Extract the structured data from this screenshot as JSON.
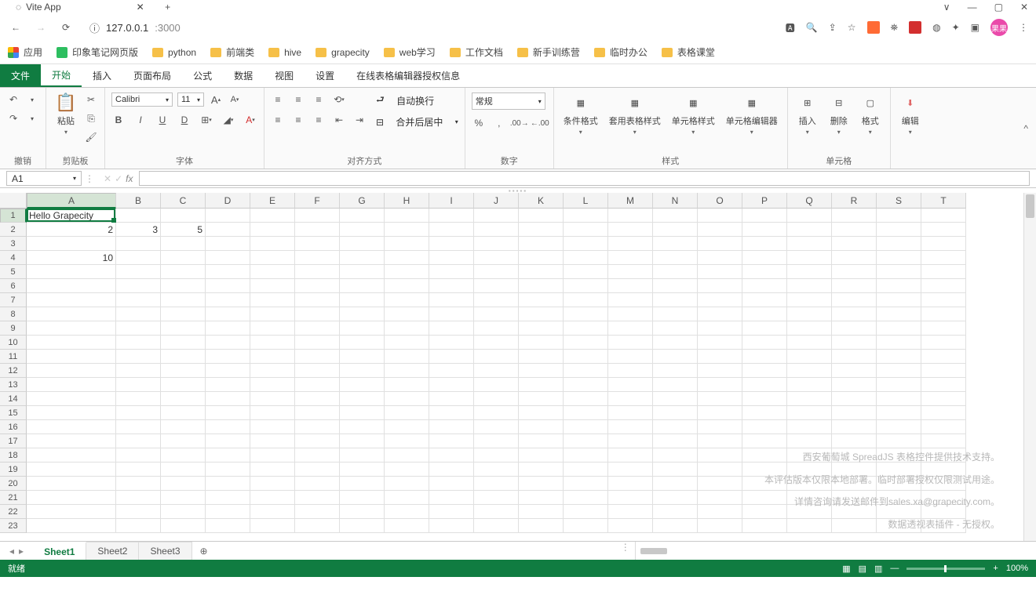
{
  "browser": {
    "tab_title": "Vite App",
    "address_info_icon": "ⓘ",
    "address_host": "127.0.0.1",
    "address_port": ":3000",
    "win_controls": {
      "more": "⋯",
      "min": "—",
      "max": "▢",
      "close": "✕"
    },
    "toolbar_icons": {
      "translate": "⤬",
      "zoom_out": "⤢",
      "share": "↗",
      "star": "☆",
      "menu": "⋮"
    },
    "avatar": "果果",
    "bookmarks": {
      "apps": "应用",
      "items": [
        "印象笔记网页版",
        "python",
        "前端类",
        "hive",
        "grapecity",
        "web学习",
        "工作文档",
        "新手训练营",
        "临时办公",
        "表格课堂"
      ]
    }
  },
  "ribbon": {
    "tabs": [
      "文件",
      "开始",
      "插入",
      "页面布局",
      "公式",
      "数据",
      "视图",
      "设置",
      "在线表格编辑器授权信息"
    ],
    "active_tab_index": 1,
    "groups": {
      "undo": "撤销",
      "clipboard": "剪贴板",
      "clipboard_paste": "粘贴",
      "font": "字体",
      "font_name": "Calibri",
      "font_size": "11",
      "align": "对齐方式",
      "wrap": "自动换行",
      "merge": "合并后居中",
      "number": "数字",
      "number_format": "常规",
      "styles": "样式",
      "style_cond": "条件格式",
      "style_table": "套用表格样式",
      "style_cell": "单元格样式",
      "style_editor": "单元格编辑器",
      "cells": "单元格",
      "cells_insert": "插入",
      "cells_delete": "删除",
      "cells_format": "格式",
      "editing": "编辑"
    }
  },
  "cell_ref": "A1",
  "columns": [
    "A",
    "B",
    "C",
    "D",
    "E",
    "F",
    "G",
    "H",
    "I",
    "J",
    "K",
    "L",
    "M",
    "N",
    "O",
    "P",
    "Q",
    "R",
    "S",
    "T"
  ],
  "rows": 23,
  "cells": {
    "A1": "Hello Grapecity",
    "A2": "2",
    "B2": "3",
    "C2": "5",
    "A4": "10"
  },
  "sheets": [
    "Sheet1",
    "Sheet2",
    "Sheet3"
  ],
  "active_sheet": 0,
  "status": {
    "ready": "就绪",
    "zoom": "100%"
  },
  "watermark": {
    "l1": "西安葡萄城 SpreadJS 表格控件提供技术支持。",
    "l2": "本评估版本仅限本地部署。临时部署授权仅限测试用途。",
    "l3": "详情咨询请发送邮件到sales.xa@grapecity.com。",
    "l4": "数据透视表插件 - 无授权。"
  }
}
